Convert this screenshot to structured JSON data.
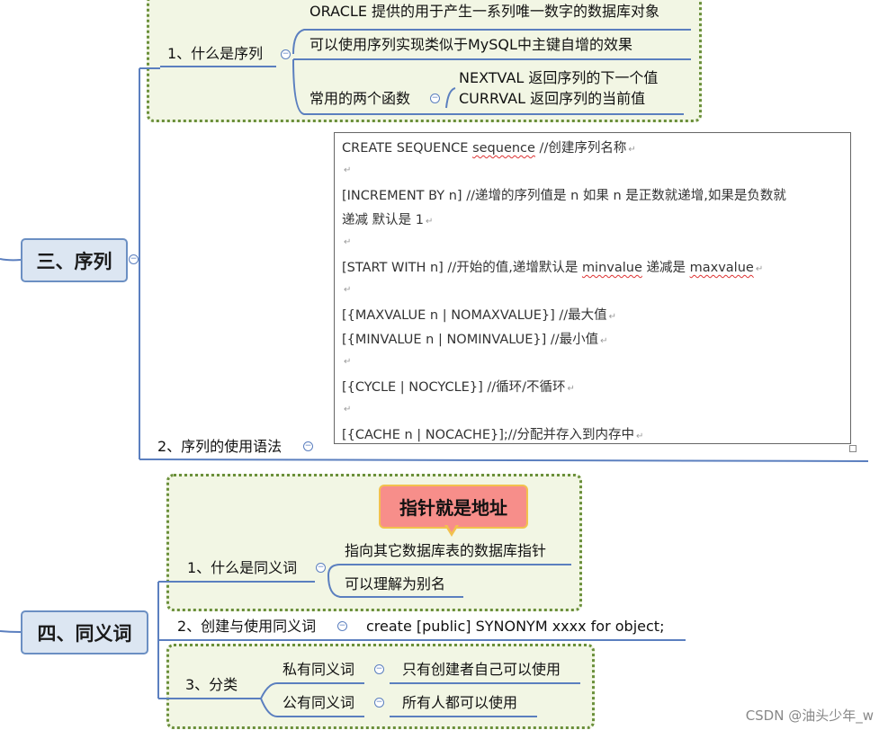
{
  "seq": {
    "root": "三、序列",
    "n1": "1、什么是序列",
    "n1_children": [
      "ORACLE 提供的用于产生一系列唯一数字的数据库对象",
      "可以使用序列实现类似于MySQL中主键自增的效果"
    ],
    "n1_c3": "常用的两个函数",
    "n1_c3_children": [
      "NEXTVAL 返回序列的下一个值",
      "CURRVAL 返回序列的当前值"
    ],
    "n2": "2、序列的使用语法",
    "code": {
      "l1a": "CREATE SEQUENCE ",
      "l1b": "sequence",
      "l1c": "   //创建序列名称",
      "l2": "[INCREMENT BY n]    //递增的序列值是  n  如果  n  是正数就递增,如果是负数就",
      "l3": "递减  默认是  1",
      "l4a": "[START WITH n]         //开始的值,递增默认是  ",
      "l4b": "minvalue",
      "l4c": "  递减是  ",
      "l4d": "maxvalue",
      "l5": "[{MAXVALUE n | NOMAXVALUE}] //最大值",
      "l6": "[{MINVALUE n | NOMINVALUE}] //最小值",
      "l7": "[{CYCLE | NOCYCLE}] //循环/不循环",
      "l8": "[{CACHE n | NOCACHE}];//分配并存入到内存中"
    }
  },
  "syn": {
    "root": "四、同义词",
    "callout": "指针就是地址",
    "n1": "1、什么是同义词",
    "n1_children": [
      "指向其它数据库表的数据库指针",
      "可以理解为别名"
    ],
    "n2": "2、创建与使用同义词",
    "n2_child": "create [public] SYNONYM xxxx for object;",
    "n3": "3、分类",
    "n3_children": [
      {
        "label": "私有同义词",
        "child": "只有创建者自己可以使用"
      },
      {
        "label": "公有同义词",
        "child": "所有人都可以使用"
      }
    ]
  },
  "toggle_symbol": "−",
  "return_mark": "↵",
  "watermark": "CSDN @油头少年_w",
  "colors": {
    "line": "#5b7fbf",
    "frame": "#6a8f3a",
    "callout": "#f78e8a",
    "root_fill": "#dce6f2"
  }
}
